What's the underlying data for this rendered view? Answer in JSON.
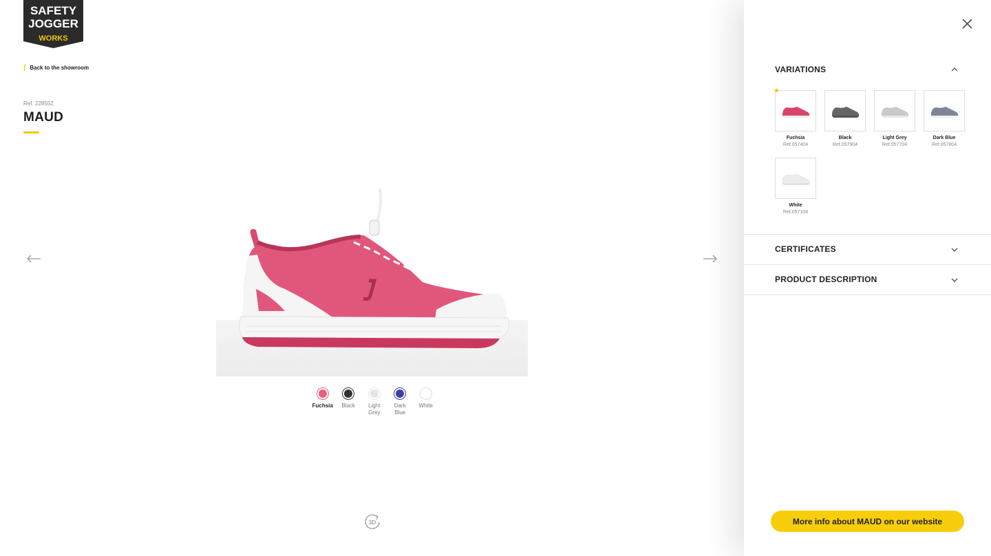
{
  "brand": {
    "logo_line1": "SAFETY",
    "logo_line2": "JOGGER",
    "logo_line3": "WORKS"
  },
  "nav": {
    "back_label": "Back to the showroom"
  },
  "product": {
    "ref": "Ref. 228552",
    "name": "MAUD",
    "swatches": [
      {
        "label": "Fuchsia",
        "color": "#e8607c",
        "active": true
      },
      {
        "label": "Black",
        "color": "#333333",
        "active": false
      },
      {
        "label": "Light Grey",
        "color": "#e4e4e4",
        "active": false
      },
      {
        "label": "Dark Blue",
        "color": "#3a40a8",
        "active": false
      },
      {
        "label": "White",
        "color": "#ffffff",
        "active": false
      }
    ],
    "view_3d_label": "3D"
  },
  "panel": {
    "variations_title": "VARIATIONS",
    "variations": [
      {
        "name": "Fuchsia",
        "ref": "Ref.057404",
        "color": "#d9456a"
      },
      {
        "name": "Black",
        "ref": "Ref.057904",
        "color": "#666666"
      },
      {
        "name": "Light Grey",
        "ref": "Ref.057704",
        "color": "#c9c9c9"
      },
      {
        "name": "Dark Blue",
        "ref": "Ref.057804",
        "color": "#7d8596"
      },
      {
        "name": "White",
        "ref": "Ref.057104",
        "color": "#ececec"
      }
    ],
    "certificates_title": "CERTIFICATES",
    "description_title": "PRODUCT DESCRIPTION",
    "more_info_label": "More info about MAUD on our website"
  },
  "colors": {
    "accent": "#f8ce0c",
    "brand_dark": "#2b2b2b"
  }
}
